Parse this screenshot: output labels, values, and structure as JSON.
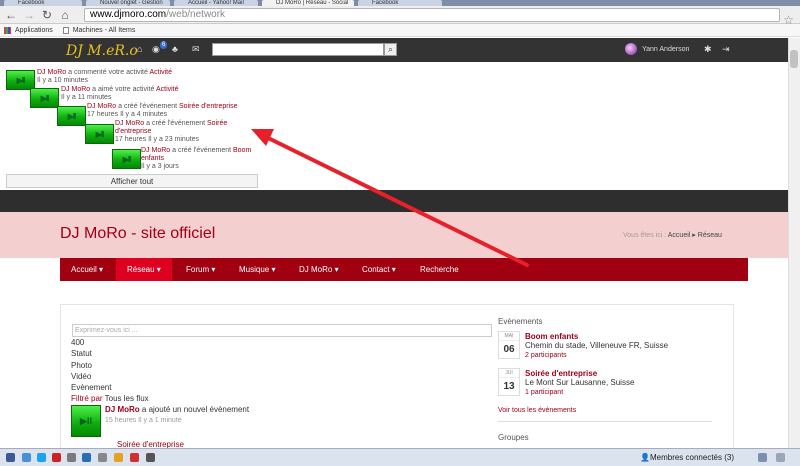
{
  "browser": {
    "tabs": [
      "Facebook",
      "Nouvel onglet - Gestion",
      "Accueil - Yahoo! Mail",
      "DJ MoRo | Réseau - Social",
      "Facebook"
    ],
    "url_domain": "www.djmoro.com",
    "url_path": "/web/network",
    "bookmarks": [
      "Applications",
      "Machines - All Items"
    ]
  },
  "sitebar": {
    "logo": "DJ M.eR.o",
    "notif_count": "6",
    "user_name": "Yann Anderson"
  },
  "activities": [
    {
      "name": "DJ MoRo",
      "text": " a commenté votre activité ",
      "link": "Activité",
      "link2": "",
      "time": "Il y a 10 minutes",
      "tile": "▶II"
    },
    {
      "name": "DJ MoRo",
      "text": " a aimé votre activité ",
      "link": "Activité",
      "link2": "",
      "time": "Il y a 11 minutes",
      "tile": "▶II"
    },
    {
      "name": "DJ MoRo",
      "text": " a créé l'événement ",
      "link": "Soirée d'entreprise",
      "link2": "",
      "time": "17 heures Il y a 4 minutes",
      "tile": "▶II"
    },
    {
      "name": "DJ MoRo",
      "text": " a créé l'événement ",
      "link": "Soirée",
      "link2": "d'entreprise",
      "time": "17 heures Il y a 23 minutes",
      "tile": "▶II"
    },
    {
      "name": "DJ MoRo",
      "text": " a créé l'événement ",
      "link": "Boom",
      "link2": "enfants",
      "time": "Il y a 3 jours",
      "tile": "▶II"
    }
  ],
  "show_all": "Afficher tout",
  "site": {
    "title": "DJ MoRo - site officiel",
    "breadcrumb_prefix": "Vous êtes ici :",
    "breadcrumb_home": "Accueil",
    "breadcrumb_sep": "▸",
    "breadcrumb_current": "Réseau"
  },
  "nav": [
    {
      "label": "Accueil ▾",
      "active": false
    },
    {
      "label": "Réseau ▾",
      "active": true
    },
    {
      "label": "Forum ▾",
      "active": false
    },
    {
      "label": "Musique ▾",
      "active": false
    },
    {
      "label": "DJ MoRo ▾",
      "active": false
    },
    {
      "label": "Contact ▾",
      "active": false
    },
    {
      "label": "Recherche",
      "active": false
    }
  ],
  "feed": {
    "status_placeholder": "Exprimez-vous ici ...",
    "char_count": "400",
    "types": [
      "Statut",
      "Photo",
      "Vidéo",
      "Evènement"
    ],
    "filter_label": "Filtré par",
    "filter_value": " Tous les flux",
    "item_name": "DJ MoRo",
    "item_text": " a ajouté un nouvel évènement",
    "item_time": "15 heures Il y a 1 minute",
    "item_next": "Soirée d'entreprise",
    "tile": "▶II"
  },
  "events_panel": {
    "heading": "Evènements",
    "events": [
      {
        "month": "MAI",
        "day": "06",
        "title": "Boom enfants",
        "place": "Chemin du stade, Villeneuve FR, Suisse",
        "participants": "2 participants"
      },
      {
        "month": "JUI",
        "day": "13",
        "title": "Soirée d'entreprise",
        "place": "Le Mont Sur Lausanne, Suisse",
        "participants": "1 participant"
      }
    ],
    "all_link": "Voir tous les évènements",
    "groups_heading": "Groupes"
  },
  "taskbar": {
    "members": "Membres connectés (3)",
    "colors": [
      "#3b5998",
      "#4a90d9",
      "#1da1f2",
      "#cc2222",
      "#7a7a7a",
      "#2d6cb5",
      "#888888",
      "#e8a020",
      "#d03030",
      "#555555"
    ]
  },
  "colors": {
    "accent": "#a10010",
    "accent_active": "#de0020",
    "arrow": "#e8202a"
  }
}
